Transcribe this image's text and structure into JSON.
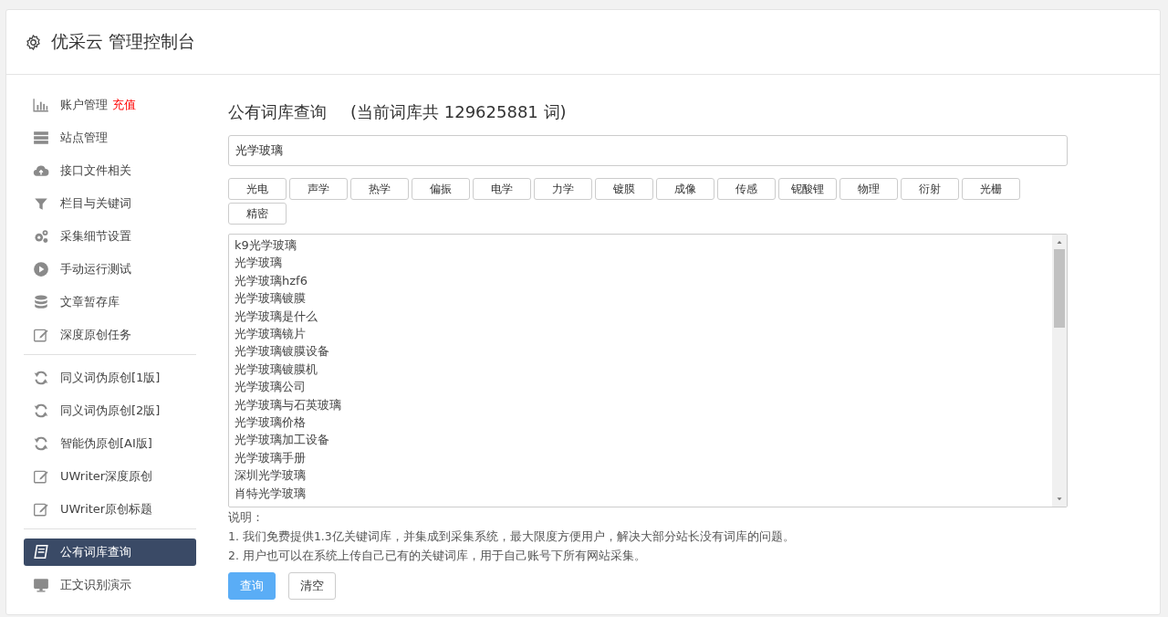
{
  "header": {
    "title": "优采云 管理控制台"
  },
  "sidebar": {
    "groups": [
      [
        {
          "label": "账户管理",
          "badge": "充值",
          "selected": false
        },
        {
          "label": "站点管理",
          "selected": false
        },
        {
          "label": "接口文件相关",
          "selected": false
        },
        {
          "label": "栏目与关键词",
          "selected": false
        },
        {
          "label": "采集细节设置",
          "selected": false
        },
        {
          "label": "手动运行测试",
          "selected": false
        },
        {
          "label": "文章暂存库",
          "selected": false
        },
        {
          "label": "深度原创任务",
          "selected": false
        }
      ],
      [
        {
          "label": "同义词伪原创[1版]",
          "selected": false
        },
        {
          "label": "同义词伪原创[2版]",
          "selected": false
        },
        {
          "label": "智能伪原创[AI版]",
          "selected": false
        },
        {
          "label": "UWriter深度原创",
          "selected": false
        },
        {
          "label": "UWriter原创标题",
          "selected": false
        }
      ],
      [
        {
          "label": "公有词库查询",
          "selected": true
        },
        {
          "label": "正文识别演示",
          "selected": false
        }
      ]
    ]
  },
  "main": {
    "title": "公有词库查询",
    "subtitle": "(当前词库共 129625881 词)",
    "search": {
      "value": "光学玻璃"
    },
    "tags": [
      "光电",
      "声学",
      "热学",
      "偏振",
      "电学",
      "力学",
      "镀膜",
      "成像",
      "传感",
      "铌酸锂",
      "物理",
      "衍射",
      "光栅",
      "精密"
    ],
    "results": [
      "k9光学玻璃",
      "光学玻璃",
      "光学玻璃hzf6",
      "光学玻璃镀膜",
      "光学玻璃是什么",
      "光学玻璃镜片",
      "光学玻璃镀膜设备",
      "光学玻璃镀膜机",
      "光学玻璃公司",
      "光学玻璃与石英玻璃",
      "光学玻璃价格",
      "光学玻璃加工设备",
      "光学玻璃手册",
      "深圳光学玻璃",
      "肖特光学玻璃"
    ],
    "notes_title": "说明：",
    "notes": [
      "1. 我们免费提供1.3亿关键词库，并集成到采集系统，最大限度方便用户，解决大部分站长没有词库的问题。",
      "2. 用户也可以在系统上传自己已有的关键词库，用于自己账号下所有网站采集。"
    ],
    "buttons": [
      {
        "label": "查询",
        "kind": "primary"
      },
      {
        "label": "清空",
        "kind": "default"
      }
    ]
  }
}
